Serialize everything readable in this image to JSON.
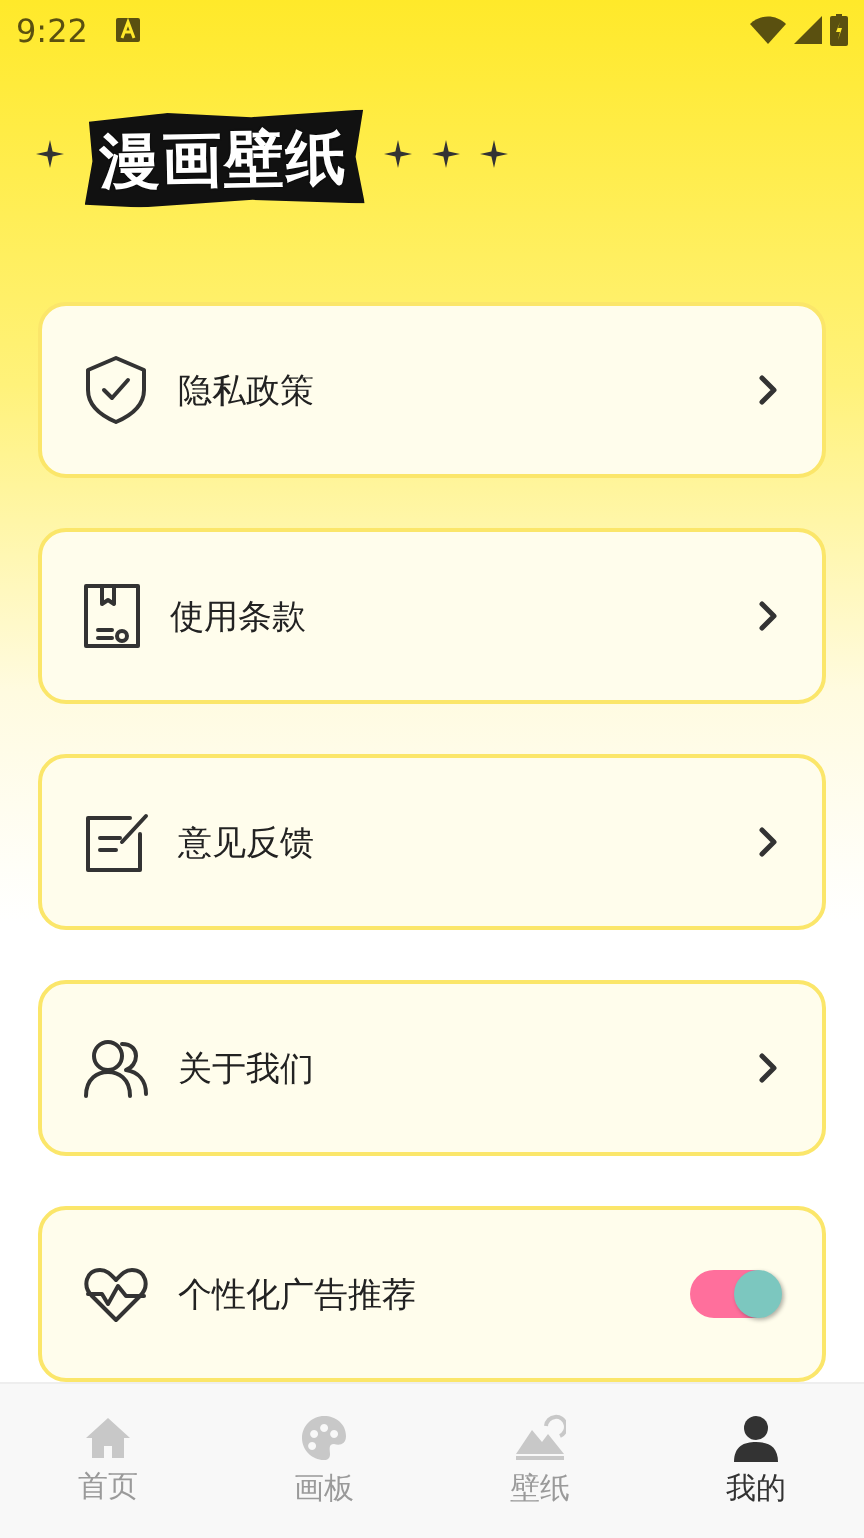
{
  "status_bar": {
    "time": "9:22"
  },
  "app_title": "漫画壁纸",
  "menu": [
    {
      "kind": "link",
      "label": "隐私政策"
    },
    {
      "kind": "link",
      "label": "使用条款"
    },
    {
      "kind": "link",
      "label": "意见反馈"
    },
    {
      "kind": "link",
      "label": "关于我们"
    },
    {
      "kind": "toggle",
      "label": "个性化广告推荐",
      "on": true
    }
  ],
  "tabs": [
    {
      "label": "首页",
      "selected": false
    },
    {
      "label": "画板",
      "selected": false
    },
    {
      "label": "壁纸",
      "selected": false
    },
    {
      "label": "我的",
      "selected": true
    }
  ]
}
